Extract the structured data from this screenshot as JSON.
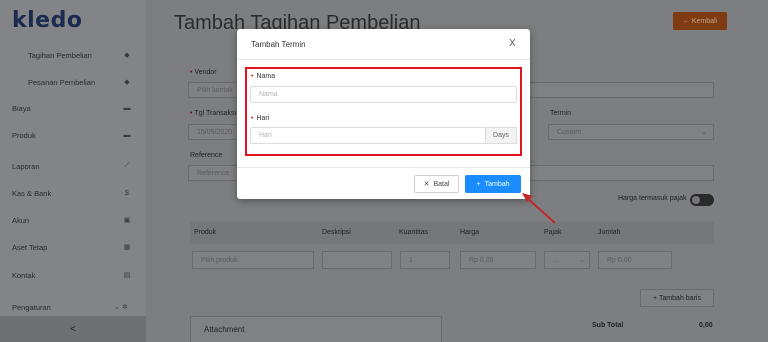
{
  "app": {
    "logo": "kledo"
  },
  "sidebar": {
    "items": [
      {
        "label": "Tagihan Pembelian",
        "icon": "tag-icon"
      },
      {
        "label": "Pesanan Pembelian",
        "icon": "tag-icon"
      },
      {
        "label": "Biaya",
        "icon": "card-icon"
      },
      {
        "label": "Produk",
        "icon": "box-icon"
      },
      {
        "label": "Laporan",
        "icon": "chart-icon"
      },
      {
        "label": "Kas & Bank",
        "icon": "dollar-icon"
      },
      {
        "label": "Akun",
        "icon": "book-icon"
      },
      {
        "label": "Aset Tetap",
        "icon": "building-icon"
      },
      {
        "label": "Kontak",
        "icon": "contact-icon"
      },
      {
        "label": "Pengaturan",
        "icon": "gear-icon"
      }
    ],
    "collapse_glyph": "<"
  },
  "page": {
    "title": "Tambah Tagihan Pembelian",
    "back_label": "← Kembali",
    "vendor_label": "Vendor",
    "vendor_placeholder": "Pilih kontak",
    "tgl_label": "Tgl Transaksi",
    "tgl_value": "15/05/2020",
    "termin_label": "Termin",
    "termin_value": "Custom",
    "reference_label": "Reference",
    "reference_placeholder": "Reference",
    "harga_pajak_label": "Harga termasuk pajak",
    "columns": [
      "Produk",
      "Deskripsi",
      "Kuantitas",
      "Harga",
      "Pajak",
      "Jumlah"
    ],
    "row": {
      "produk_placeholder": "Pilih produk",
      "kuantitas": "1",
      "harga": "Rp 0,00",
      "pajak": "...",
      "jumlah": "Rp 0,00"
    },
    "add_row_label": "+ Tambah baris",
    "attachment_label": "Attachment",
    "subtotal_label": "Sub Total",
    "subtotal_value": "0,00"
  },
  "modal": {
    "title": "Tambah Termin",
    "close_glyph": "X",
    "nama_label": "Nama",
    "nama_placeholder": "Nama",
    "hari_label": "Hari",
    "hari_placeholder": "Hari",
    "hari_addon": "Days",
    "batal_label": "Batal",
    "tambah_label": "Tambah"
  },
  "colors": {
    "highlight": "#e0141e",
    "primary": "#1a8cff",
    "annotation_arrow": "#c0282a"
  }
}
